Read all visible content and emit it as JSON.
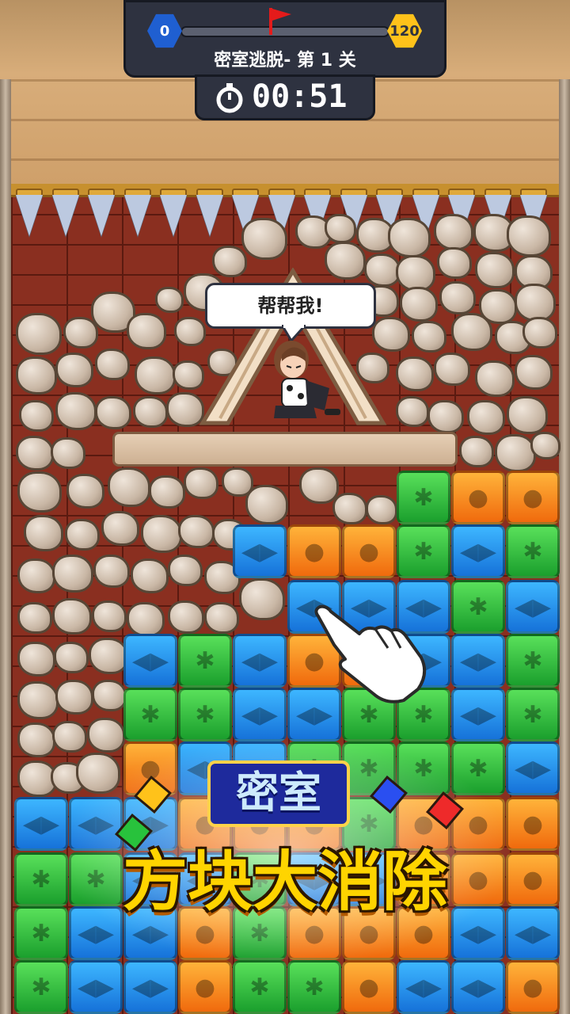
{
  "hud": {
    "progress_start": "0",
    "progress_goal": "120",
    "level_title": "密室逃脱- 第 1 关",
    "timer": "00:51",
    "progress_fraction": 0.0
  },
  "scene": {
    "speech_bubble": "帮帮我!"
  },
  "logo": {
    "line1": "密室",
    "line2": "方块大消除"
  },
  "colors": {
    "blue_block": "#2a8ef0",
    "green_block": "#2fbf3f",
    "orange_block": "#f58a1f",
    "brick_wall": "#8a2f20",
    "hud_bg": "#2e3240"
  },
  "board": {
    "block_types": [
      "blue-arrow",
      "green-pineapple",
      "orange-bomb"
    ]
  }
}
